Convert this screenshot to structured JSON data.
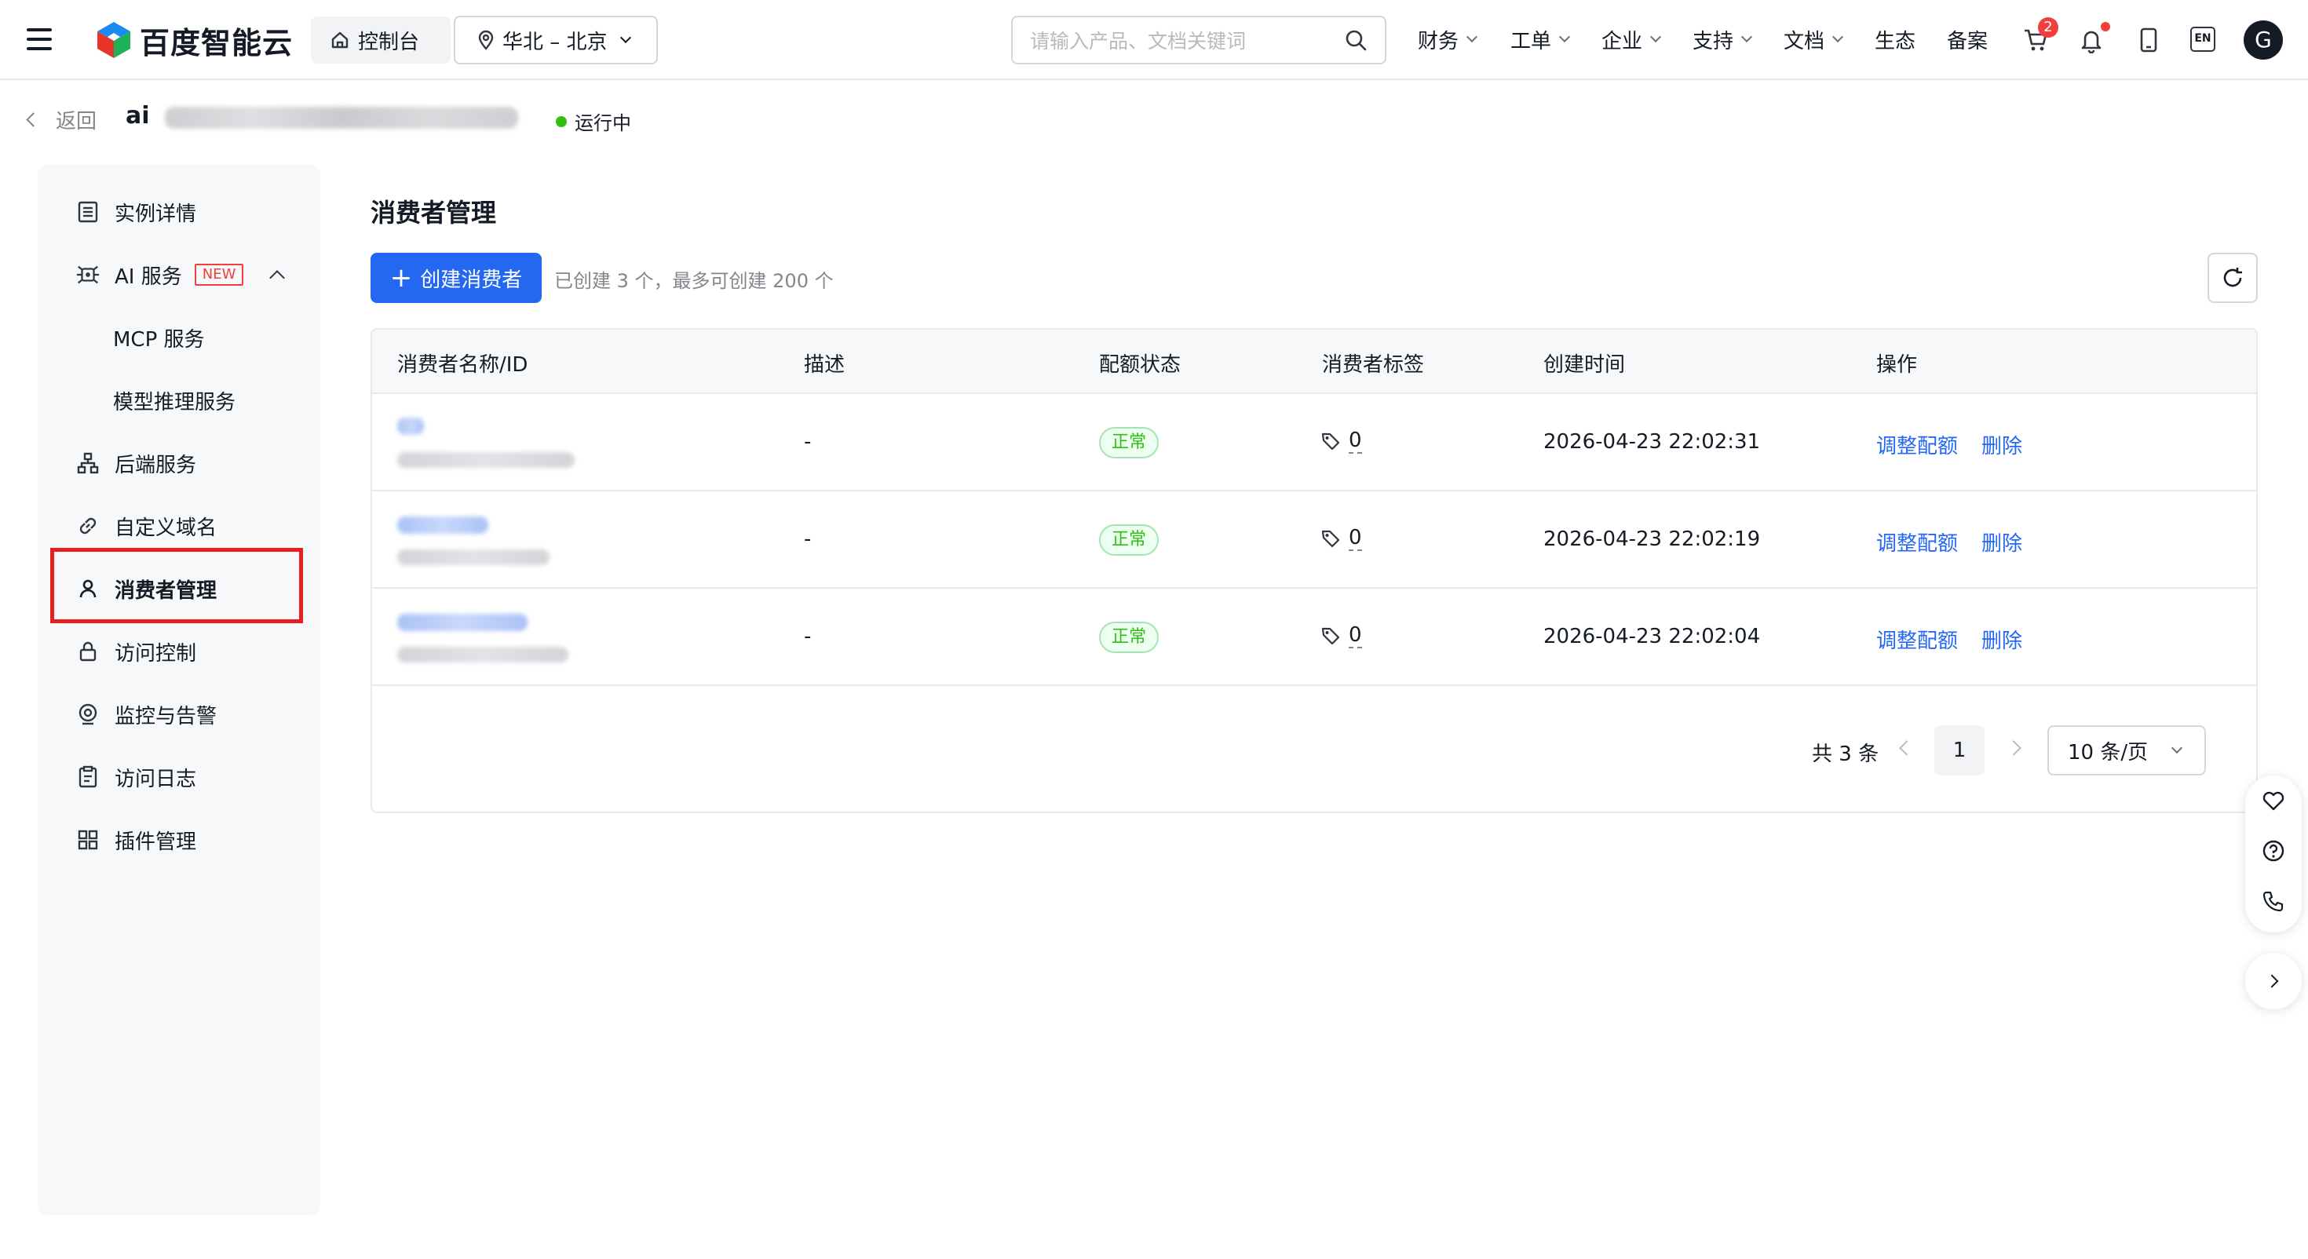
{
  "topnav": {
    "brand": "百度智能云",
    "console_label": "控制台",
    "region_label": "华北 – 北京",
    "search_placeholder": "请输入产品、文档关键词",
    "menus": [
      {
        "label": "财务",
        "has_dropdown": true
      },
      {
        "label": "工单",
        "has_dropdown": true
      },
      {
        "label": "企业",
        "has_dropdown": true
      },
      {
        "label": "支持",
        "has_dropdown": true
      },
      {
        "label": "文档",
        "has_dropdown": true
      },
      {
        "label": "生态",
        "has_dropdown": false
      },
      {
        "label": "备案",
        "has_dropdown": false
      }
    ],
    "cart_badge": "2",
    "lang_label": "EN",
    "avatar_letter": "G",
    "icons": [
      "menu-icon",
      "home-icon",
      "location-icon",
      "search-icon",
      "cart-icon",
      "bell-icon",
      "mobile-icon",
      "language-icon"
    ]
  },
  "header": {
    "back_label": "返回",
    "instance_title_visible": "ai",
    "status_label": "运行中",
    "status_color": "#30bf13"
  },
  "sidebar": {
    "items": [
      {
        "label": "实例详情",
        "icon": "list-doc-icon"
      },
      {
        "label": "AI 服务",
        "icon": "ai-icon",
        "tag": "NEW",
        "expanded": true
      },
      {
        "label": "MCP 服务",
        "sub": true
      },
      {
        "label": "模型推理服务",
        "sub": true
      },
      {
        "label": "后端服务",
        "icon": "hierarchy-icon"
      },
      {
        "label": "自定义域名",
        "icon": "link-icon"
      },
      {
        "label": "消费者管理",
        "icon": "user-icon",
        "active": true
      },
      {
        "label": "访问控制",
        "icon": "lock-icon"
      },
      {
        "label": "监控与告警",
        "icon": "monitor-icon"
      },
      {
        "label": "访问日志",
        "icon": "log-icon"
      },
      {
        "label": "插件管理",
        "icon": "grid-icon"
      }
    ]
  },
  "main": {
    "title": "消费者管理",
    "create_button": "创建消费者",
    "quota_hint": "已创建 3 个，最多可创建 200 个",
    "table": {
      "columns": [
        "消费者名称/ID",
        "描述",
        "配额状态",
        "消费者标签",
        "创建时间",
        "操作"
      ],
      "rows": [
        {
          "description": "-",
          "quota_status": "正常",
          "tag_count": "0",
          "created_at": "2026-04-23 22:02:31",
          "actions": [
            "调整配额",
            "删除"
          ]
        },
        {
          "description": "-",
          "quota_status": "正常",
          "tag_count": "0",
          "created_at": "2026-04-23 22:02:19",
          "actions": [
            "调整配额",
            "删除"
          ]
        },
        {
          "description": "-",
          "quota_status": "正常",
          "tag_count": "0",
          "created_at": "2026-04-23 22:02:04",
          "actions": [
            "调整配额",
            "删除"
          ]
        }
      ]
    },
    "pagination": {
      "total_label": "共 3 条",
      "current_page": "1",
      "page_size_label": "10 条/页"
    }
  },
  "colors": {
    "primary": "#2468f2",
    "success": "#30bf13",
    "danger": "#f33e3e",
    "highlight_box": "#e62020"
  }
}
